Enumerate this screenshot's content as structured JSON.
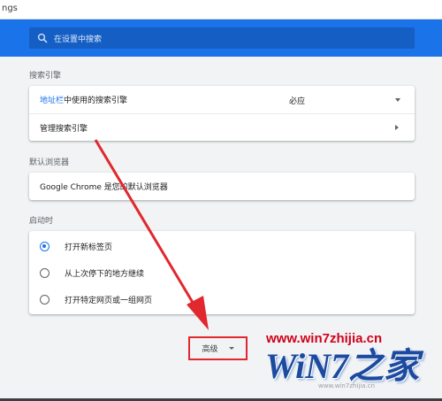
{
  "browser": {
    "url_fragment": "ngs"
  },
  "search": {
    "placeholder": "在设置中搜索"
  },
  "search_engine": {
    "title": "搜索引擎",
    "address_bar_link": "地址栏",
    "address_bar_suffix": "中使用的搜索引擎",
    "selected_engine": "必应",
    "manage_label": "管理搜索引擎"
  },
  "default_browser": {
    "title": "默认浏览器",
    "status": "Google Chrome 是您的默认浏览器"
  },
  "on_startup": {
    "title": "启动时",
    "options": [
      {
        "label": "打开新标签页",
        "checked": true
      },
      {
        "label": "从上次停下的地方继续",
        "checked": false
      },
      {
        "label": "打开特定网页或一组网页",
        "checked": false
      }
    ]
  },
  "advanced": {
    "label": "高级"
  },
  "watermark": {
    "url": "www.win7zhijia.cn",
    "logo": "WiN7之家",
    "sub": "www.win7zhijia.cn"
  },
  "colors": {
    "accent": "#1a73e8",
    "annotation": "#e0282e",
    "watermark_red": "#d0021b",
    "watermark_blue": "#1c4aa0"
  }
}
